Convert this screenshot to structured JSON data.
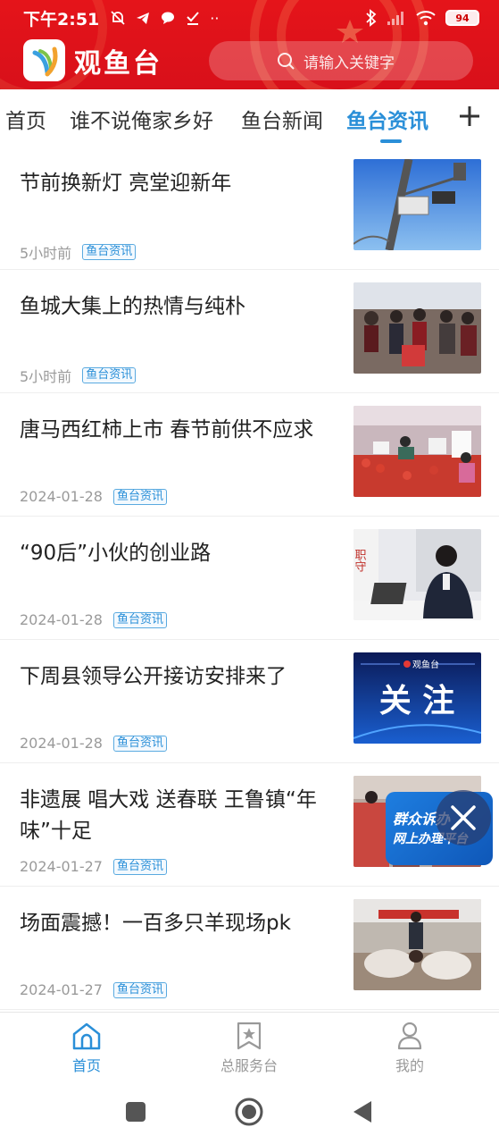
{
  "status_bar": {
    "time": "下午2:51",
    "battery": "94"
  },
  "header": {
    "app_title": "观鱼台",
    "search_placeholder": "请输入关键字"
  },
  "tabs": [
    {
      "label": "首页",
      "active": false
    },
    {
      "label": "谁不说俺家乡好",
      "active": false
    },
    {
      "label": "鱼台新闻",
      "active": false
    },
    {
      "label": "鱼台资讯",
      "active": true
    }
  ],
  "news": [
    {
      "title": "节前换新灯  亮堂迎新年",
      "time": "5小时前",
      "tag": "鱼台资讯"
    },
    {
      "title": "鱼城大集上的热情与纯朴",
      "time": "5小时前",
      "tag": "鱼台资讯"
    },
    {
      "title": "唐马西红柿上市  春节前供不应求",
      "time": "2024-01-28",
      "tag": "鱼台资讯"
    },
    {
      "title": "“90后”小伙的创业路",
      "time": "2024-01-28",
      "tag": "鱼台资讯",
      "thumb_text": "职守"
    },
    {
      "title": "下周县领导公开接访安排来了",
      "time": "2024-01-28",
      "tag": "鱼台资讯",
      "thumb_brand": "观鱼台",
      "thumb_text": "关 注"
    },
    {
      "title": "非遗展  唱大戏  送春联  王鲁镇“年味”十足",
      "time": "2024-01-27",
      "tag": "鱼台资讯"
    },
    {
      "title": "场面震撼！一百多只羊现场pk",
      "time": "2024-01-27",
      "tag": "鱼台资讯"
    }
  ],
  "float_ad": {
    "line1": "群众诉办",
    "line2": "网上办理平台"
  },
  "bottom_nav": [
    {
      "label": "首页",
      "icon": "home-icon",
      "active": true
    },
    {
      "label": "总服务台",
      "icon": "bookmark-star-icon",
      "active": false
    },
    {
      "label": "我的",
      "icon": "person-icon",
      "active": false
    }
  ],
  "colors": {
    "header_red": "#e5141a",
    "accent_blue": "#2a8fd8"
  }
}
